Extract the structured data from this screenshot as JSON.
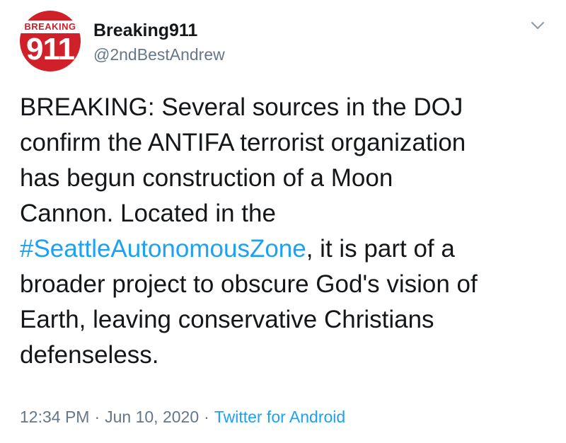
{
  "user": {
    "display_name": "Breaking911",
    "handle": "@2ndBestAndrew",
    "avatar_banner_text": "BREAKING",
    "avatar_number_text": "911"
  },
  "tweet": {
    "text_before": "BREAKING: Several sources in the DOJ\nconfirm the ANTIFA terrorist organization\nhas begun construction of a Moon\nCannon. Located in the\n",
    "hashtag": "#SeattleAutonomousZone",
    "text_after": ", it is part of a\nbroader project to obscure God's vision of\nEarth, leaving conservative Christians\ndefenseless."
  },
  "meta": {
    "time": "12:34 PM",
    "separator": "·",
    "date": "Jun 10, 2020",
    "source": "Twitter for Android"
  },
  "icons": {
    "more_menu": "chevron-down-icon"
  },
  "colors": {
    "accent": "#1da1f2",
    "text_primary": "#14171a",
    "text_secondary": "#657786",
    "avatar_red": "#d0202a"
  }
}
